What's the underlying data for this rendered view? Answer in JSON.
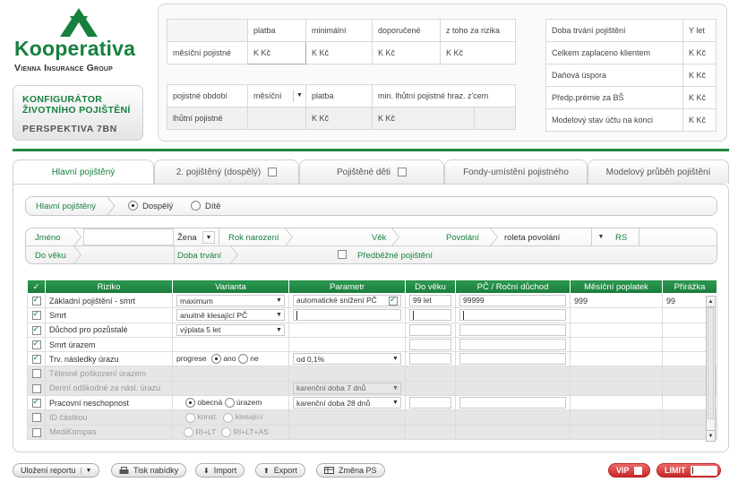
{
  "brand": {
    "name": "Kooperativa",
    "subtitle": "Vienna Insurance Group",
    "config_title": "KONFIGURÁTOR ŽIVOTNÍHO POJIŠTĚNÍ",
    "product": "PERSPEKTIVA 7BN"
  },
  "summary": {
    "header": [
      "platba",
      "minimální",
      "doporučené",
      "z toho za rizika"
    ],
    "monthly_label": "měsíční pojistné",
    "monthly_values": [
      "K Kč",
      "K Kč",
      "K Kč",
      "K Kč"
    ],
    "period_label": "pojistné období",
    "period_value": "měsíční",
    "period_platba": "platba",
    "period_min_label": "min. lhůtní pojistné hraz. z'cem",
    "lhutni_label": "lhůtní pojistné",
    "lhutni_values": [
      "K Kč",
      "K Kč"
    ],
    "right": [
      {
        "label": "Doba trvání pojištění",
        "value": "Y let"
      },
      {
        "label": "Celkem zaplaceno klientem",
        "value": "K Kč"
      },
      {
        "label": "Daňová úspora",
        "value": "K Kč"
      },
      {
        "label": "Předp.prémie za BŠ",
        "value": "K Kč"
      },
      {
        "label": "Modelový stav účtu na konci",
        "value": "K Kč"
      }
    ]
  },
  "tabs": [
    {
      "label": "Hlavní pojištěný",
      "active": true
    },
    {
      "label": "2. pojištěný (dospělý)"
    },
    {
      "label": "Pojištěné děti"
    },
    {
      "label": "Fondy-umístění pojistného"
    },
    {
      "label": "Modelový průběh pojištění"
    }
  ],
  "breadcrumb": {
    "item": "Hlavní pojištěný",
    "option1": "Dospělý",
    "option2": "Dítě"
  },
  "form": {
    "jmeno": "Jméno",
    "pohlavi": "Žena",
    "rok_narozeni": "Rok narození",
    "vek": "Věk",
    "povolani": "Povolání",
    "roleta": "roleta povolání",
    "rs": "RS",
    "do_veku": "Do věku",
    "doba_trvani": "Doba trvání",
    "predbezne": "Předběžné pojištění"
  },
  "table": {
    "check_header": "✓",
    "headers": [
      "Riziko",
      "Varianta",
      "Parametr",
      "Do věku",
      "PČ / Roční důchod",
      "Měsíční poplatek",
      "Přirážka"
    ],
    "rows": [
      {
        "checked": true,
        "name": "Základní pojištění - smrt",
        "variant": "maximum",
        "param": "automatické snížení PČ",
        "param_check": true,
        "age": "99 let",
        "pc": "99999",
        "fee": "999",
        "sur": "99"
      },
      {
        "checked": true,
        "name": "Smrt",
        "variant": "anuitně klesající PČ"
      },
      {
        "checked": true,
        "name": "Důchod pro pozůstalé",
        "variant": "výplata 5 let"
      },
      {
        "checked": true,
        "name": "Smrt úrazem"
      },
      {
        "checked": true,
        "name": "Trv. následky úrazu",
        "variant_a": "progrese",
        "variant_b": "ano",
        "variant_c": "ne",
        "param": "od 0,1%"
      },
      {
        "checked": false,
        "disabled": true,
        "name": "Tělesné poškození úrazem"
      },
      {
        "checked": false,
        "disabled": true,
        "name": "Denní odškodné za násl. úrazu",
        "param": "karenční doba 7 dnů"
      },
      {
        "checked": true,
        "name": "Pracovní neschopnost",
        "variant_a": "obecná",
        "variant_b": "úrazem",
        "param": "karenční doba 28 dnů"
      },
      {
        "checked": false,
        "disabled": true,
        "name": "ID částkou",
        "variant_a": "konst.",
        "variant_b": "klesající"
      },
      {
        "checked": false,
        "disabled": true,
        "name": "MediKompas",
        "variant_a": "RI+LT",
        "variant_b": "RI+LT+AS"
      }
    ]
  },
  "toolbar": {
    "ulozeni": "Uložení reportu",
    "tisk": "Tisk nabídky",
    "import": "Import",
    "export": "Export",
    "zmena": "Změna PS",
    "vip": "VIP",
    "limit": "LIMIT"
  },
  "colors": {
    "brand_green": "#17803f",
    "header_green": "#1f8a42",
    "red": "#c62828"
  }
}
